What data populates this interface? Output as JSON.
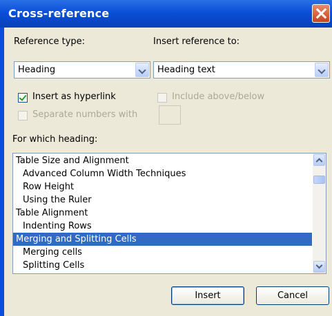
{
  "window": {
    "title": "Cross-reference"
  },
  "reference_type": {
    "label": "Reference type:",
    "value": "Heading"
  },
  "insert_reference_to": {
    "label": "Insert reference to:",
    "value": "Heading text"
  },
  "insert_as_hyperlink": {
    "label": "Insert as hyperlink",
    "checked": true
  },
  "include_above_below": {
    "label": "Include above/below",
    "checked": false,
    "enabled": false
  },
  "separate_numbers": {
    "label": "Separate numbers with",
    "checked": false,
    "enabled": false,
    "value": ""
  },
  "heading_list": {
    "label": "For which heading:",
    "selected_index": 6,
    "items": [
      "Table Size and Alignment",
      "Advanced Column Width Techniques",
      "Row Height",
      "Using the Ruler",
      "Table Alignment",
      "Indenting Rows",
      "Merging and Splitting Cells",
      "Merging cells",
      "Splitting Cells"
    ]
  },
  "buttons": {
    "insert": "Insert",
    "cancel": "Cancel"
  }
}
